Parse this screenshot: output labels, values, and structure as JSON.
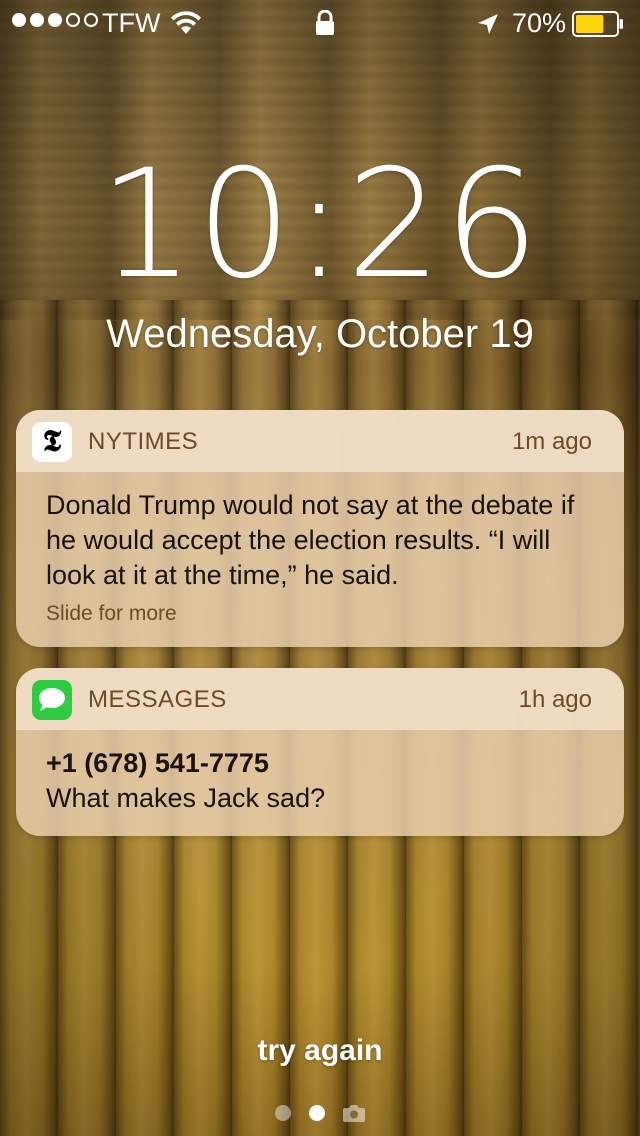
{
  "status_bar": {
    "signal_bars_filled": 3,
    "signal_bars_total": 5,
    "carrier": "TFW",
    "battery_percent": "70%",
    "battery_level": 0.7,
    "battery_color": "#ffd60a"
  },
  "lock_screen": {
    "time": "10:26",
    "date": "Wednesday, October 19"
  },
  "notifications": [
    {
      "app": "NYTIMES",
      "icon": "nytimes-logo-icon",
      "time_ago": "1m ago",
      "message": "Donald Trump would not say at the debate if he would accept the election results. “I will look at it at the time,” he said.",
      "hint": "Slide for more"
    },
    {
      "app": "MESSAGES",
      "icon": "messages-bubble-icon",
      "icon_color": "#2ecc40",
      "time_ago": "1h ago",
      "sender": "+1 (678) 541-7775",
      "message": "What makes Jack sad?"
    }
  ],
  "bottom": {
    "prompt": "try again",
    "pages": 2,
    "active_page": 2
  }
}
